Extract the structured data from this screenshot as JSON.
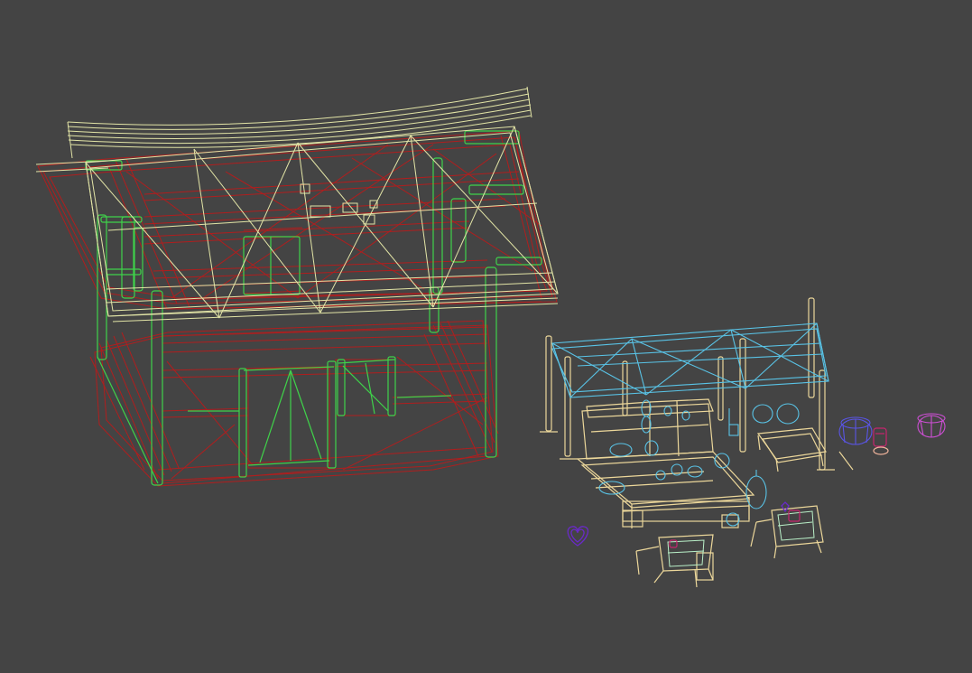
{
  "viewport": {
    "background": "#444444"
  },
  "colors": {
    "house_frame": "#b01e1e",
    "house_green": "#3fd24a",
    "roof_cream": "#e2e4a6",
    "stall_cream": "#ecd79a",
    "stall_cyan": "#59c3e6",
    "mint": "#b9f0c8",
    "blue_basket": "#5a55e6",
    "magenta_basket": "#cf4fd6",
    "purple_heart": "#6a2ac8",
    "red_vase": "#c8246e",
    "peach_bowl": "#f0b49c"
  }
}
